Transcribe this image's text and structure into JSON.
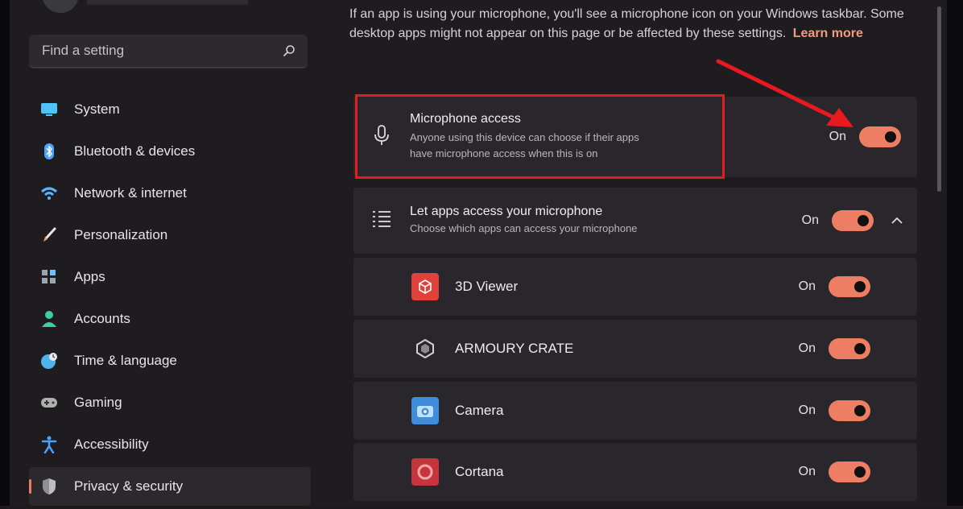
{
  "search": {
    "placeholder": "Find a setting"
  },
  "sidebar": {
    "items": [
      {
        "label": "System",
        "icon": "monitor-icon",
        "color": "#4fc3f7"
      },
      {
        "label": "Bluetooth & devices",
        "icon": "bluetooth-icon",
        "color": "#4aa3ff"
      },
      {
        "label": "Network & internet",
        "icon": "wifi-icon",
        "color": "#5ab5ff"
      },
      {
        "label": "Personalization",
        "icon": "paintbrush-icon",
        "color": "#f0a060"
      },
      {
        "label": "Apps",
        "icon": "apps-icon",
        "color": "#9aa5b1"
      },
      {
        "label": "Accounts",
        "icon": "person-icon",
        "color": "#3fcf9f"
      },
      {
        "label": "Time & language",
        "icon": "globe-clock-icon",
        "color": "#4fb3ef"
      },
      {
        "label": "Gaming",
        "icon": "gamepad-icon",
        "color": "#b0b0b0"
      },
      {
        "label": "Accessibility",
        "icon": "accessibility-icon",
        "color": "#4aa3ff"
      },
      {
        "label": "Privacy & security",
        "icon": "shield-icon",
        "color": "#bdbdbd",
        "selected": true
      }
    ]
  },
  "intro": {
    "text": "If an app is using your microphone, you'll see a microphone icon on your Windows taskbar. Some desktop apps might not appear on this page or be affected by these settings.",
    "link": "Learn more"
  },
  "mic_access": {
    "title": "Microphone access",
    "subtitle_line1": "Anyone using this device can choose if their apps",
    "subtitle_line2": "have microphone access when this is on",
    "state": "On"
  },
  "apps_access": {
    "title": "Let apps access your microphone",
    "subtitle": "Choose which apps can access your microphone",
    "state": "On"
  },
  "apps": [
    {
      "name": "3D Viewer",
      "state": "On",
      "icon": "cube-icon",
      "color": "#e2413b"
    },
    {
      "name": "ARMOURY CRATE",
      "state": "On",
      "icon": "armoury-crate-icon",
      "color": "#2a272c"
    },
    {
      "name": "Camera",
      "state": "On",
      "icon": "camera-icon",
      "color": "#3f8ede"
    },
    {
      "name": "Cortana",
      "state": "On",
      "icon": "cortana-icon",
      "color": "#c7343c"
    }
  ],
  "colors": {
    "accent": "#ed7d63",
    "highlight_box": "#e21d22",
    "link": "#f39a7e"
  }
}
